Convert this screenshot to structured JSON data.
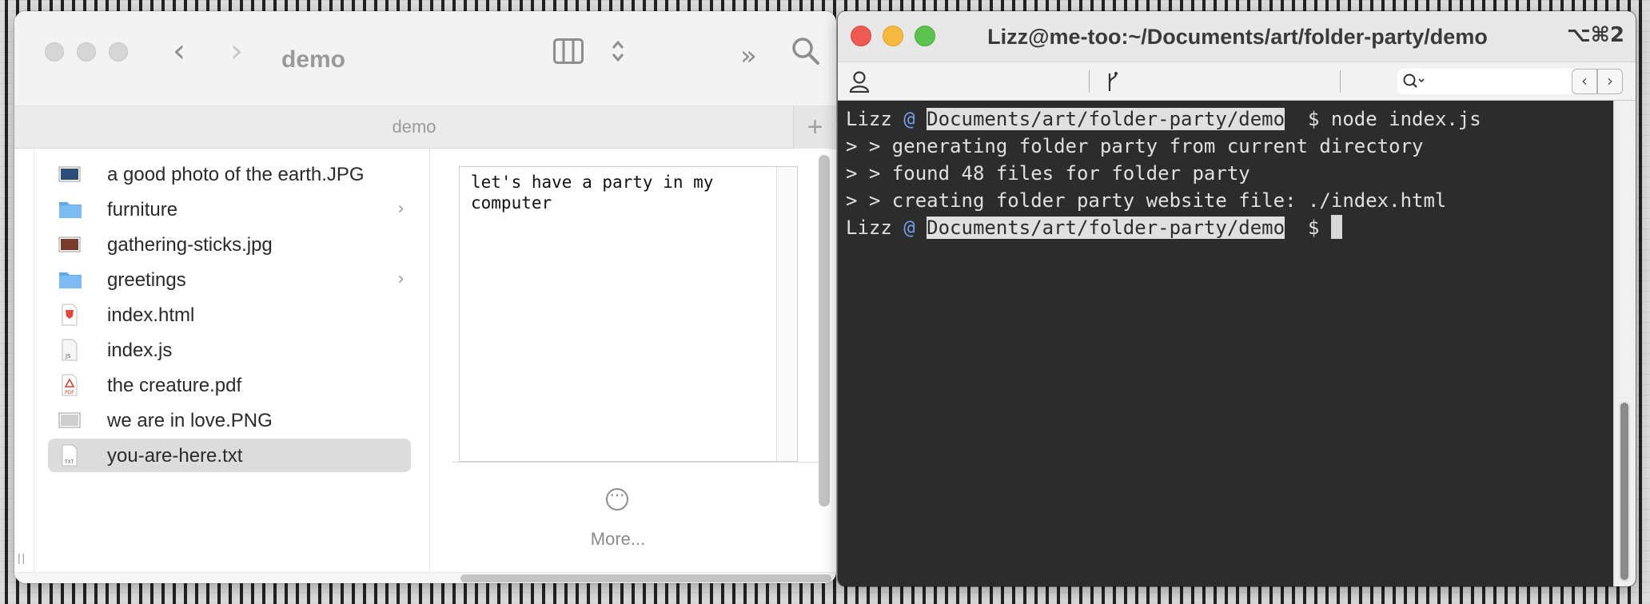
{
  "finder": {
    "title": "demo",
    "tab_title": "demo",
    "add_tab": "+",
    "files": [
      {
        "name": "a good photo of the earth.JPG",
        "icon": "image-thumbnail-icon",
        "folder": false
      },
      {
        "name": "furniture",
        "icon": "folder-icon",
        "folder": true
      },
      {
        "name": "gathering-sticks.jpg",
        "icon": "image-thumbnail-icon",
        "folder": false
      },
      {
        "name": "greetings",
        "icon": "folder-icon",
        "folder": true
      },
      {
        "name": "index.html",
        "icon": "html-document-icon",
        "folder": false
      },
      {
        "name": "index.js",
        "icon": "js-document-icon",
        "folder": false
      },
      {
        "name": "the creature.pdf",
        "icon": "pdf-document-icon",
        "folder": false
      },
      {
        "name": "we are in love.PNG",
        "icon": "image-thumbnail-icon",
        "folder": false
      },
      {
        "name": "you-are-here.txt",
        "icon": "txt-document-icon",
        "folder": false,
        "selected": true
      }
    ],
    "preview_text": "let's have a party in my computer",
    "more_label": "More...",
    "folder_color": "#5ea9ec"
  },
  "terminal": {
    "title": "Lizz@me-too:~/Documents/art/folder-party/demo",
    "shortcut": "⌥⌘2",
    "lines": [
      {
        "user": "Lizz",
        "at": "@",
        "path": "Documents/art/folder-party/demo",
        "prompt": "$",
        "command": "node index.js"
      },
      {
        "text": "> > generating folder party from current directory"
      },
      {
        "text": "> > found 48 files for folder party"
      },
      {
        "text": "> > creating folder party website file: ./index.html"
      },
      {
        "user": "Lizz",
        "at": "@",
        "path": "Documents/art/folder-party/demo",
        "prompt": "$",
        "command": ""
      }
    ],
    "colors": {
      "background": "#2c2c2c",
      "at_sign": "#6d9ee8",
      "close": "#ee5a52",
      "minimize": "#f5b93e",
      "zoom": "#5dc34f"
    }
  }
}
